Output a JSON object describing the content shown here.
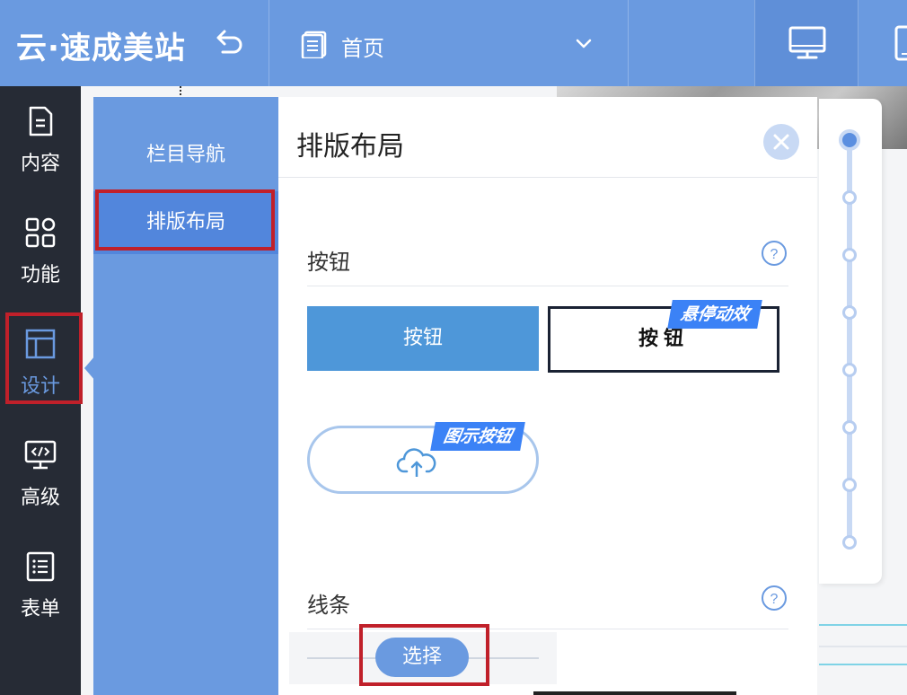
{
  "header": {
    "brand": "云·速成美站",
    "page_name": "首页",
    "icons": [
      "undo-icon",
      "page-icon",
      "chevron-down-icon",
      "desktop-icon",
      "mobile-icon"
    ]
  },
  "rail": {
    "items": [
      {
        "label": "内容",
        "icon": "document-icon"
      },
      {
        "label": "功能",
        "icon": "grid-icon"
      },
      {
        "label": "设计",
        "icon": "layout-icon",
        "active": true
      },
      {
        "label": "高级",
        "icon": "code-monitor-icon"
      },
      {
        "label": "表单",
        "icon": "list-icon"
      }
    ]
  },
  "subnav": {
    "items": [
      {
        "label": "栏目导航"
      },
      {
        "label": "排版布局",
        "active": true
      }
    ]
  },
  "panel": {
    "title": "排版布局",
    "sections": {
      "button": {
        "title": "按钮",
        "solid_label": "按钮",
        "outline_label": "按钮",
        "hover_tag": "悬停动效",
        "icon_tag": "图示按钮"
      },
      "line": {
        "title": "线条",
        "select_label": "选择"
      }
    }
  },
  "colors": {
    "primary": "#6a9ae0",
    "rail": "#262b35",
    "highlight": "#c0202a",
    "tag": "#3b82f6"
  }
}
